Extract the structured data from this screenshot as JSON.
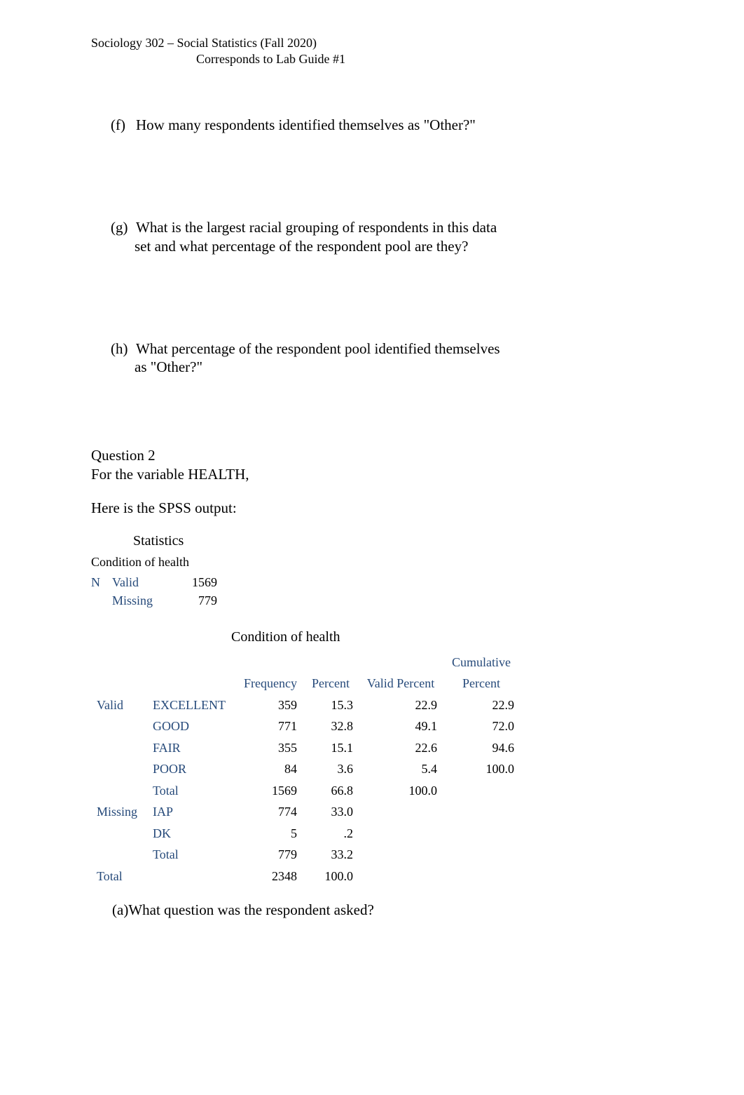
{
  "header": {
    "line1": "Sociology 302 – Social Statistics (Fall 2020)",
    "line2": "Corresponds to Lab Guide #1"
  },
  "questions": {
    "f": {
      "label": "(f)",
      "text": "How many respondents identified themselves as \"Other?\""
    },
    "g": {
      "label": "(g)",
      "text1": "What is the largest racial grouping of respondents in this data",
      "text2": "set and what percentage of the respondent pool are they?"
    },
    "h": {
      "label": "(h)",
      "text1": "What percentage of the respondent pool identified themselves",
      "text2": "as \"Other?\""
    },
    "a": {
      "label": "(a)",
      "text": "What question was the respondent asked?"
    }
  },
  "section": {
    "q2": "Question 2",
    "varline": "For the variable HEALTH,",
    "outputline": "Here is the SPSS output:"
  },
  "stats": {
    "title": "Statistics",
    "subtitle": "Condition of health",
    "n": "N",
    "valid_label": "Valid",
    "valid_value": "1569",
    "missing_label": "Missing",
    "missing_value": "779"
  },
  "freq": {
    "title": "Condition of health",
    "headers": {
      "frequency": "Frequency",
      "percent": "Percent",
      "valid_percent": "Valid Percent",
      "cumulative": "Cumulative",
      "cumulative2": "Percent"
    },
    "groups": {
      "valid": "Valid",
      "missing": "Missing",
      "total": "Total"
    },
    "rows": [
      {
        "group": "Valid",
        "cat": "EXCELLENT",
        "freq": "359",
        "pct": "15.3",
        "vpct": "22.9",
        "cpct": "22.9"
      },
      {
        "group": "",
        "cat": "GOOD",
        "freq": "771",
        "pct": "32.8",
        "vpct": "49.1",
        "cpct": "72.0"
      },
      {
        "group": "",
        "cat": "FAIR",
        "freq": "355",
        "pct": "15.1",
        "vpct": "22.6",
        "cpct": "94.6"
      },
      {
        "group": "",
        "cat": "POOR",
        "freq": "84",
        "pct": "3.6",
        "vpct": "5.4",
        "cpct": "100.0"
      },
      {
        "group": "",
        "cat": "Total",
        "freq": "1569",
        "pct": "66.8",
        "vpct": "100.0",
        "cpct": ""
      },
      {
        "group": "Missing",
        "cat": "IAP",
        "freq": "774",
        "pct": "33.0",
        "vpct": "",
        "cpct": ""
      },
      {
        "group": "",
        "cat": "DK",
        "freq": "5",
        "pct": ".2",
        "vpct": "",
        "cpct": ""
      },
      {
        "group": "",
        "cat": "Total",
        "freq": "779",
        "pct": "33.2",
        "vpct": "",
        "cpct": ""
      },
      {
        "group": "Total",
        "cat": "",
        "freq": "2348",
        "pct": "100.0",
        "vpct": "",
        "cpct": ""
      }
    ]
  },
  "chart_data": {
    "type": "table",
    "title": "Condition of health",
    "columns": [
      "Category",
      "Frequency",
      "Percent",
      "Valid Percent",
      "Cumulative Percent"
    ],
    "rows": [
      [
        "Valid EXCELLENT",
        359,
        15.3,
        22.9,
        22.9
      ],
      [
        "Valid GOOD",
        771,
        32.8,
        49.1,
        72.0
      ],
      [
        "Valid FAIR",
        355,
        15.1,
        22.6,
        94.6
      ],
      [
        "Valid POOR",
        84,
        3.6,
        5.4,
        100.0
      ],
      [
        "Valid Total",
        1569,
        66.8,
        100.0,
        null
      ],
      [
        "Missing IAP",
        774,
        33.0,
        null,
        null
      ],
      [
        "Missing DK",
        5,
        0.2,
        null,
        null
      ],
      [
        "Missing Total",
        779,
        33.2,
        null,
        null
      ],
      [
        "Total",
        2348,
        100.0,
        null,
        null
      ]
    ],
    "statistics": {
      "N_valid": 1569,
      "N_missing": 779
    }
  }
}
